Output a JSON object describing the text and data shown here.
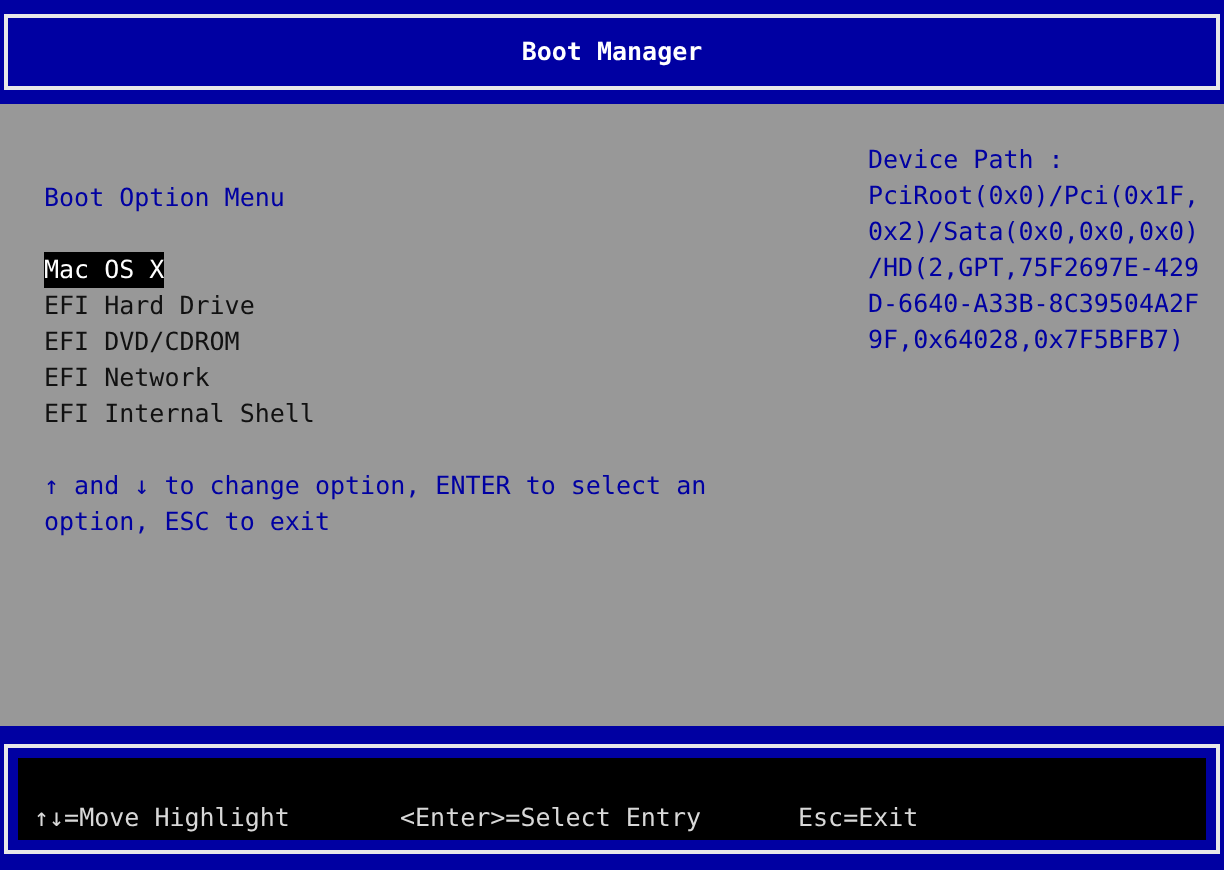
{
  "header": {
    "title": "Boot Manager"
  },
  "menu": {
    "title": "Boot Option Menu",
    "options": [
      {
        "label": "Mac OS X",
        "selected": true
      },
      {
        "label": "EFI Hard Drive",
        "selected": false
      },
      {
        "label": "EFI DVD/CDROM",
        "selected": false
      },
      {
        "label": "EFI Network",
        "selected": false
      },
      {
        "label": "EFI Internal Shell",
        "selected": false
      }
    ],
    "help_lines": [
      "↑ and ↓ to change option, ENTER to select an",
      "option, ESC to exit"
    ]
  },
  "device_path": {
    "label": "Device Path :",
    "lines": [
      "PciRoot(0x0)/Pci(0x1F,",
      "0x2)/Sata(0x0,0x0,0x0)",
      "/HD(2,GPT,75F2697E-429",
      "D-6640-A33B-8C39504A2F",
      "9F,0x64028,0x7F5BFB7)"
    ]
  },
  "footer": {
    "hints": [
      "↑↓=Move Highlight",
      "<Enter>=Select Entry",
      "Esc=Exit"
    ]
  }
}
